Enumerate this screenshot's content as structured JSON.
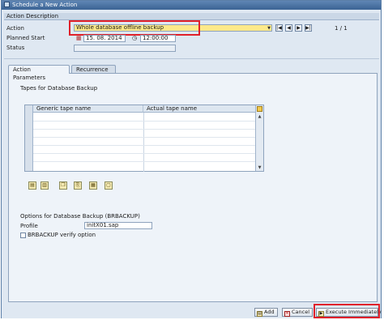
{
  "window": {
    "title": "Schedule a New Action"
  },
  "action_description": {
    "header": "Action Description",
    "action_label": "Action",
    "action_value": "Whole database offline backup",
    "page_counter": "1 / 1",
    "planned_start_label": "Planned Start",
    "planned_date": "15. 08. 2014",
    "planned_time": "12:00:00",
    "status_label": "Status",
    "status_value": ""
  },
  "nav_buttons": [
    "|◀",
    "◀",
    "▶",
    "▶|"
  ],
  "tabs": [
    {
      "label": "Action Parameters",
      "active": true
    },
    {
      "label": "Recurrence",
      "active": false
    }
  ],
  "tapes": {
    "group_title": "Tapes for Database Backup",
    "columns": [
      "Generic tape name",
      "Actual tape name"
    ]
  },
  "table_toolbar_icons": [
    "insert-row-icon",
    "delete-row-icon",
    "copy-icon",
    "paste-icon",
    "select-all-icon",
    "deselect-all-icon"
  ],
  "options": {
    "group_title": "Options for Database Backup (BRBACKUP)",
    "profile_label": "Profile",
    "profile_value": "initX01.sap",
    "verify_label": "BRBACKUP verify option",
    "verify_checked": false
  },
  "footer": {
    "add_label": "Add",
    "cancel_label": "Cancel",
    "execute_label": "Execute Immediately"
  },
  "colors": {
    "highlight": "#e0202a",
    "action_field": "#fde98a",
    "title_bar": "#3b6394"
  }
}
